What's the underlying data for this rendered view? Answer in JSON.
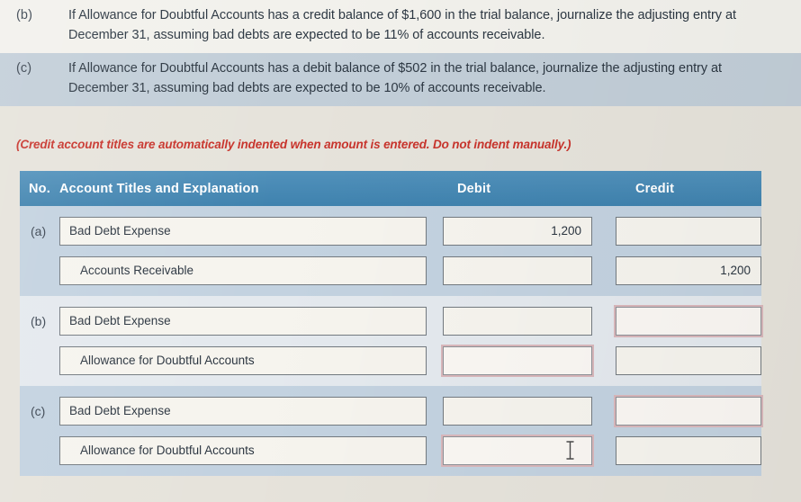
{
  "prompts": [
    {
      "label": "(b)",
      "line1": "If Allowance for Doubtful Accounts has a credit balance of $1,600 in the trial balance, journalize the adjusting entry at",
      "line2": "December 31, assuming bad debts are expected to be 11% of accounts receivable."
    },
    {
      "label": "(c)",
      "line1": "If Allowance for Doubtful Accounts has a debit balance of $502 in the trial balance, journalize the adjusting entry at",
      "line2": "December 31, assuming bad debts are expected to be 10% of accounts receivable."
    }
  ],
  "credit_note": "(Credit account titles are automatically indented when amount is entered. Do not indent manually.)",
  "table": {
    "headers": {
      "no": "No.",
      "account": "Account Titles and Explanation",
      "debit": "Debit",
      "credit": "Credit"
    },
    "groups": [
      {
        "no": "(a)",
        "lines": [
          {
            "account": "Bad Debt Expense",
            "indented": false,
            "debit": "1,200",
            "credit": "",
            "debit_error": false,
            "credit_error": false,
            "caret": false
          },
          {
            "account": "Accounts Receivable",
            "indented": true,
            "debit": "",
            "credit": "1,200",
            "debit_error": false,
            "credit_error": false,
            "caret": false
          }
        ]
      },
      {
        "no": "(b)",
        "lines": [
          {
            "account": "Bad Debt Expense",
            "indented": false,
            "debit": "",
            "credit": "",
            "debit_error": false,
            "credit_error": true,
            "caret": false
          },
          {
            "account": "Allowance for Doubtful Accounts",
            "indented": true,
            "debit": "",
            "credit": "",
            "debit_error": true,
            "credit_error": false,
            "caret": false
          }
        ]
      },
      {
        "no": "(c)",
        "lines": [
          {
            "account": "Bad Debt Expense",
            "indented": false,
            "debit": "",
            "credit": "",
            "debit_error": false,
            "credit_error": true,
            "caret": false
          },
          {
            "account": "Allowance for Doubtful Accounts",
            "indented": true,
            "debit": "",
            "credit": "",
            "debit_error": true,
            "credit_error": false,
            "caret": true
          }
        ]
      }
    ]
  },
  "colors": {
    "header_blue": "#4a8ab5",
    "row_band_blue": "#c3d2e0",
    "row_band_light": "#e4e9ee",
    "note_red": "#c8342c",
    "page_bg": "#e6e3db",
    "field_bg": "#f6f4ee",
    "error_outline": "#d9b7bb"
  }
}
